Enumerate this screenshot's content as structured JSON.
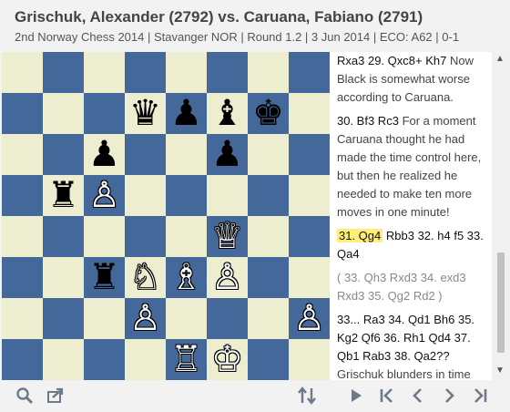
{
  "header": {
    "title": "Grischuk, Alexander (2792) vs. Caruana, Fabiano (2791)",
    "subtitle": "2nd Norway Chess 2014 | Stavanger NOR | Round 1.2 | 3 Jun 2014 | ECO: A62 | 0-1"
  },
  "board": {
    "ranks": [
      [
        "",
        "",
        "",
        "",
        "",
        "",
        "",
        ""
      ],
      [
        "",
        "",
        "",
        "bQ",
        "bP",
        "bB",
        "bK",
        ""
      ],
      [
        "",
        "",
        "bP",
        "",
        "",
        "bP",
        "",
        ""
      ],
      [
        "",
        "bR",
        "wP",
        "",
        "",
        "",
        "",
        ""
      ],
      [
        "",
        "",
        "",
        "",
        "",
        "wQ",
        "",
        ""
      ],
      [
        "",
        "",
        "bR",
        "wN",
        "wB",
        "wP",
        "",
        ""
      ],
      [
        "",
        "",
        "",
        "wP",
        "",
        "",
        "",
        "wP"
      ],
      [
        "",
        "",
        "",
        "",
        "wR",
        "wK",
        "",
        ""
      ]
    ],
    "colors": {
      "light": "#ededd0",
      "dark": "#45689a"
    }
  },
  "moves": {
    "p1_move": "Rxa3  29. Qxc8+  Kh7",
    "p1_comment": "Now Black is somewhat worse according to Caruana.",
    "p2_move": "30. Bf3  Rc3",
    "p2_comment": "For a moment Caruana thought he had made the time control here, but then he realized he needed to make ten more moves in one minute!",
    "p3_current": "31. Qg4",
    "p3_rest": "Rbb3  32. h4  f5  33. Qa4",
    "variation": "( 33. Qh3  Rxd3  34. exd3  Rxd3  35. Qg2  Rd2 )",
    "p4_move": "33... Ra3  34. Qd1  Bh6  35. Kg2  Qf6  36. Rh1  Qd4  37. Qb1  Rab3  38. Qa2??",
    "p4_comment": "Grischuk blunders in time trouble."
  },
  "toolbar": {
    "icons": [
      "search-icon",
      "share-icon",
      "flip-board-icon",
      "play-icon",
      "first-move-icon",
      "previous-move-icon",
      "next-move-icon",
      "last-move-icon"
    ]
  }
}
